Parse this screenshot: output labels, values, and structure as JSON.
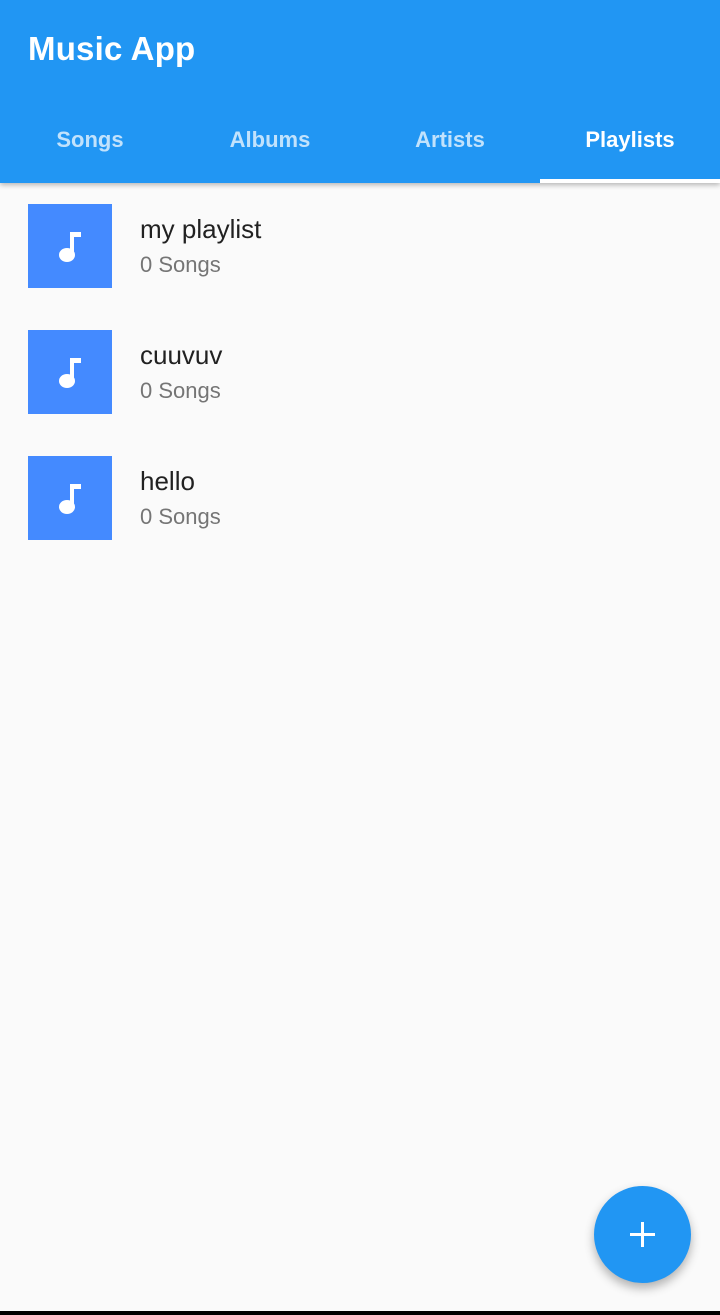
{
  "app_bar": {
    "title": "Music App",
    "color": "#2196f3"
  },
  "tabs": [
    {
      "label": "Songs",
      "selected": false
    },
    {
      "label": "Albums",
      "selected": false
    },
    {
      "label": "Artists",
      "selected": false
    },
    {
      "label": "Playlists",
      "selected": true
    }
  ],
  "playlists": [
    {
      "name": "my playlist",
      "count_label": "0 Songs",
      "icon": "music-note-icon"
    },
    {
      "name": "cuuvuv",
      "count_label": "0 Songs",
      "icon": "music-note-icon"
    },
    {
      "name": "hello",
      "count_label": "0 Songs",
      "icon": "music-note-icon"
    }
  ],
  "thumbnail_color": "#448aff",
  "fab": {
    "icon": "plus-icon",
    "color": "#2196f3"
  }
}
